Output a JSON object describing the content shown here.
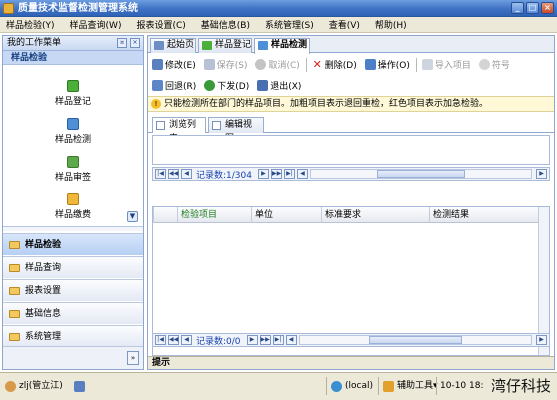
{
  "window": {
    "title": "质量技术监督检测管理系统",
    "min": "_",
    "max": "□",
    "close": "×"
  },
  "menu": [
    "样品检验(Y)",
    "样品查询(W)",
    "报表设置(C)",
    "基础信息(B)",
    "系统管理(S)",
    "查看(V)",
    "帮助(H)"
  ],
  "left": {
    "header": "我的工作菜单",
    "pin": "¤",
    "close": "×",
    "section": "样品检验",
    "items": [
      "样品登记",
      "样品检测",
      "样品审签",
      "样品缴费"
    ],
    "scroll_down": "▼",
    "categories": [
      "样品检验",
      "样品查询",
      "报表设置",
      "基础信息",
      "系统管理"
    ],
    "bottom_arrow": "»"
  },
  "tabs": [
    "起始页",
    "样品登记",
    "样品检测"
  ],
  "toolbar1": [
    "修改(E)",
    "保存(S)",
    "取消(C)",
    "删除(D)",
    "操作(O)",
    "导入项目",
    "符号"
  ],
  "toolbar2": [
    "回退(R)",
    "下发(D)",
    "退出(X)"
  ],
  "notice": "只能检测所在部门的样品项目。加粗项目表示退回重检，红色项目表示加急检验。",
  "view_tabs": [
    "浏览列表",
    "编辑视图"
  ],
  "pager_top": {
    "text": "记录数:1/304"
  },
  "pager_bottom": {
    "text": "记录数:0/0"
  },
  "grid_columns": [
    "检验项目",
    "单位",
    "标准要求",
    "检测结果"
  ],
  "hint_label": "提示",
  "status": {
    "user": "zlj(管立江)",
    "db": "(local)",
    "tools": "辅助工具▾",
    "datetime": "10-10 18:",
    "watermark": "湾仔科技"
  },
  "colors": {
    "accent": "#3f72c4",
    "notice_bg": "#fff9d8",
    "pager_text": "#1a45b0"
  }
}
